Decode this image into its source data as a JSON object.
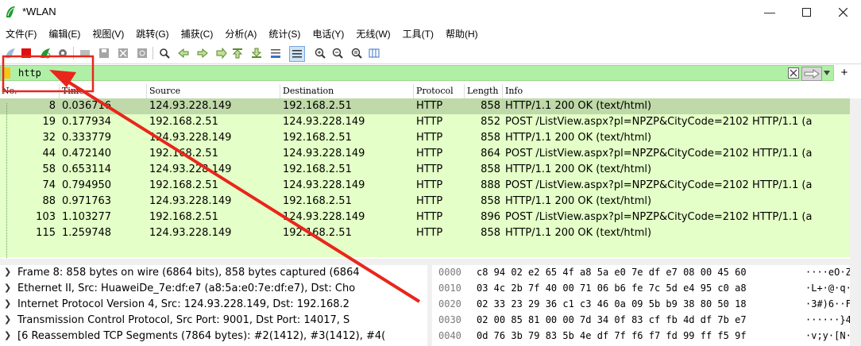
{
  "window": {
    "title": "*WLAN"
  },
  "menu": [
    "文件(F)",
    "编辑(E)",
    "视图(V)",
    "跳转(G)",
    "捕获(C)",
    "分析(A)",
    "统计(S)",
    "电话(Y)",
    "无线(W)",
    "工具(T)",
    "帮助(H)"
  ],
  "filter": {
    "value": "http"
  },
  "packet_list": {
    "columns": [
      "No.",
      "Time",
      "Source",
      "Destination",
      "Protocol",
      "Length",
      "Info"
    ],
    "rows": [
      {
        "no": "8",
        "time": "0.036716",
        "src": "124.93.228.149",
        "dst": "192.168.2.51",
        "proto": "HTTP",
        "len": "858",
        "info": "HTTP/1.1 200 OK  (text/html)"
      },
      {
        "no": "19",
        "time": "0.177934",
        "src": "192.168.2.51",
        "dst": "124.93.228.149",
        "proto": "HTTP",
        "len": "852",
        "info": "POST /ListView.aspx?pl=NPZP&CityCode=2102 HTTP/1.1  (a"
      },
      {
        "no": "32",
        "time": "0.333779",
        "src": "124.93.228.149",
        "dst": "192.168.2.51",
        "proto": "HTTP",
        "len": "858",
        "info": "HTTP/1.1 200 OK  (text/html)"
      },
      {
        "no": "44",
        "time": "0.472140",
        "src": "192.168.2.51",
        "dst": "124.93.228.149",
        "proto": "HTTP",
        "len": "864",
        "info": "POST /ListView.aspx?pl=NPZP&CityCode=2102 HTTP/1.1  (a"
      },
      {
        "no": "58",
        "time": "0.653114",
        "src": "124.93.228.149",
        "dst": "192.168.2.51",
        "proto": "HTTP",
        "len": "858",
        "info": "HTTP/1.1 200 OK  (text/html)"
      },
      {
        "no": "74",
        "time": "0.794950",
        "src": "192.168.2.51",
        "dst": "124.93.228.149",
        "proto": "HTTP",
        "len": "888",
        "info": "POST /ListView.aspx?pl=NPZP&CityCode=2102 HTTP/1.1  (a"
      },
      {
        "no": "88",
        "time": "0.971763",
        "src": "124.93.228.149",
        "dst": "192.168.2.51",
        "proto": "HTTP",
        "len": "858",
        "info": "HTTP/1.1 200 OK  (text/html)"
      },
      {
        "no": "103",
        "time": "1.103277",
        "src": "192.168.2.51",
        "dst": "124.93.228.149",
        "proto": "HTTP",
        "len": "896",
        "info": "POST /ListView.aspx?pl=NPZP&CityCode=2102 HTTP/1.1  (a"
      },
      {
        "no": "115",
        "time": "1.259748",
        "src": "124.93.228.149",
        "dst": "192.168.2.51",
        "proto": "HTTP",
        "len": "858",
        "info": "HTTP/1.1 200 OK  (text/html)"
      }
    ]
  },
  "details": [
    "Frame 8: 858 bytes on wire (6864 bits), 858 bytes captured (6864",
    "Ethernet II, Src: HuaweiDe_7e:df:e7 (a8:5a:e0:7e:df:e7), Dst: Cho",
    "Internet Protocol Version 4, Src: 124.93.228.149, Dst: 192.168.2",
    "Transmission Control Protocol, Src Port: 9001, Dst Port: 14017, S",
    "[6 Reassembled TCP Segments (7864 bytes): #2(1412), #3(1412), #4("
  ],
  "bytes": [
    {
      "off": "0000",
      "hex": "c8 94 02 e2 65 4f a8 5a  e0 7e df e7 08 00 45 60",
      "ascii": "····eO·Z ·~····E`"
    },
    {
      "off": "0010",
      "hex": "03 4c 2b 7f 40 00 71 06  b6 fe 7c 5d e4 95 c0 a8",
      "ascii": "·L+·@·q· ··|]····"
    },
    {
      "off": "0020",
      "hex": "02 33 23 29 36 c1 c3 46  0a 09 5b b9 38 80 50 18",
      "ascii": "·3#)6··F ··[·8·P·"
    },
    {
      "off": "0030",
      "hex": "02 00 85 81 00 00 7d 34  0f 83 cf fb 4d df 7b e7",
      "ascii": "······}4 ····M·{·"
    },
    {
      "off": "0040",
      "hex": "0d 76 3b 79 83 5b 4e df  7f f6 f7 fd 99 ff f5 9f",
      "ascii": "·v;y·[N· ········"
    }
  ]
}
